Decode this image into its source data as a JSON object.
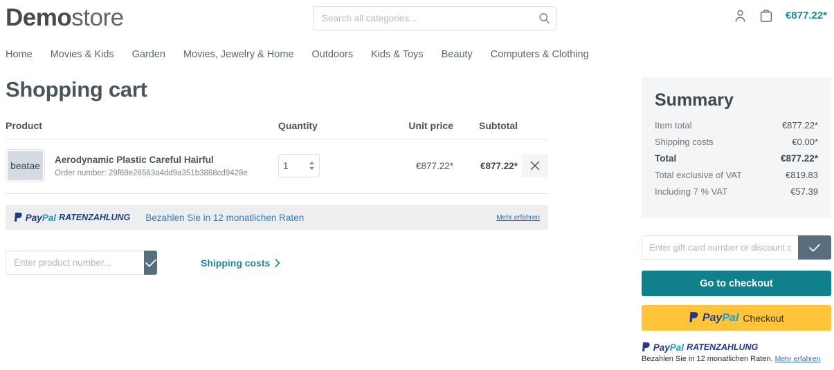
{
  "header": {
    "logo_bold": "Demo",
    "logo_light": "store",
    "search_placeholder": "Search all categories...",
    "search_value": "",
    "search_icon": "search-icon",
    "account_icon": "user-icon",
    "cart_icon": "bag-icon",
    "cart_total": "€877.22*"
  },
  "nav": {
    "items": [
      {
        "label": "Home"
      },
      {
        "label": "Movies & Kids"
      },
      {
        "label": "Garden"
      },
      {
        "label": "Movies, Jewelry & Home"
      },
      {
        "label": "Outdoors"
      },
      {
        "label": "Kids & Toys"
      },
      {
        "label": "Beauty"
      },
      {
        "label": "Computers & Clothing"
      }
    ]
  },
  "cart": {
    "title": "Shopping cart",
    "columns": {
      "product": "Product",
      "quantity": "Quantity",
      "unit_price": "Unit price",
      "subtotal": "Subtotal"
    },
    "items": [
      {
        "thumb_text": "beatae",
        "name": "Aerodynamic Plastic Careful Hairful",
        "order_number": "Order number: 29f69e26563a4dd9a351b3868cd9428e",
        "quantity": "1",
        "unit_price": "€877.22*",
        "subtotal": "€877.22*",
        "remove_label": "✕"
      }
    ],
    "paypal_banner": {
      "brand_pay": "Pay",
      "brand_pal": "Pal",
      "product": "RATENZAHLUNG",
      "text": "Bezahlen Sie in 12 monatlichen Raten",
      "link": "Mehr erfahren"
    },
    "product_number_placeholder": "Enter product number...",
    "product_number_value": "",
    "submit_icon": "check-icon",
    "shipping_costs_label": "Shipping costs",
    "shipping_chevron": "❯"
  },
  "summary": {
    "title": "Summary",
    "lines": [
      {
        "label": "Item total",
        "value": "€877.22*",
        "emphasis": false
      },
      {
        "label": "Shipping costs",
        "value": "€0.00*",
        "emphasis": false
      },
      {
        "label": "Total",
        "value": "€877.22*",
        "emphasis": true
      },
      {
        "label": "Total exclusive of VAT",
        "value": "€819.83",
        "emphasis": false
      },
      {
        "label": "Including 7 % VAT",
        "value": "€57.39",
        "emphasis": false
      }
    ],
    "gift_card_placeholder": "Enter gift card number or discount code...",
    "gift_card_value": "",
    "gift_submit_icon": "check-icon",
    "checkout_label": "Go to checkout",
    "paypal_checkout": {
      "brand_pay": "Pay",
      "brand_pal": "Pal",
      "label": "Checkout"
    },
    "paypal_footer": {
      "brand_pay": "Pay",
      "brand_pal": "Pal",
      "product": "RATENZAHLUNG",
      "text": "Bezahlen Sie in 12 monatlichen Raten.",
      "link": "Mehr erfahren"
    }
  },
  "colors": {
    "accent_teal": "#10808c",
    "slate_button": "#566e7d",
    "paypal_yellow": "#ffc43a",
    "paypal_blue_dark": "#253b80",
    "paypal_blue_light": "#179bd7",
    "panel_bg": "#f4f5f6"
  }
}
